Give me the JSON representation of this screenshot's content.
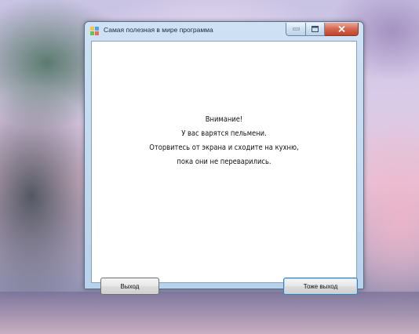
{
  "window": {
    "title": "Самая полезная в мире программа",
    "icon": "winforms-app-icon"
  },
  "controls": {
    "minimize_icon": "minimize-icon",
    "maximize_icon": "maximize-icon",
    "close_icon": "close-icon"
  },
  "message": {
    "line1": "Внимание!",
    "line2": "У вас варятся пельмени.",
    "line3": "Оторвитесь от экрана и сходите на кухню,",
    "line4": "пока они не переварились."
  },
  "buttons": {
    "exit_label": "Выход",
    "exit_too_label": "Тоже выход"
  },
  "colors": {
    "close_button": "#c2432a",
    "default_button_border": "#3c7fb1"
  }
}
